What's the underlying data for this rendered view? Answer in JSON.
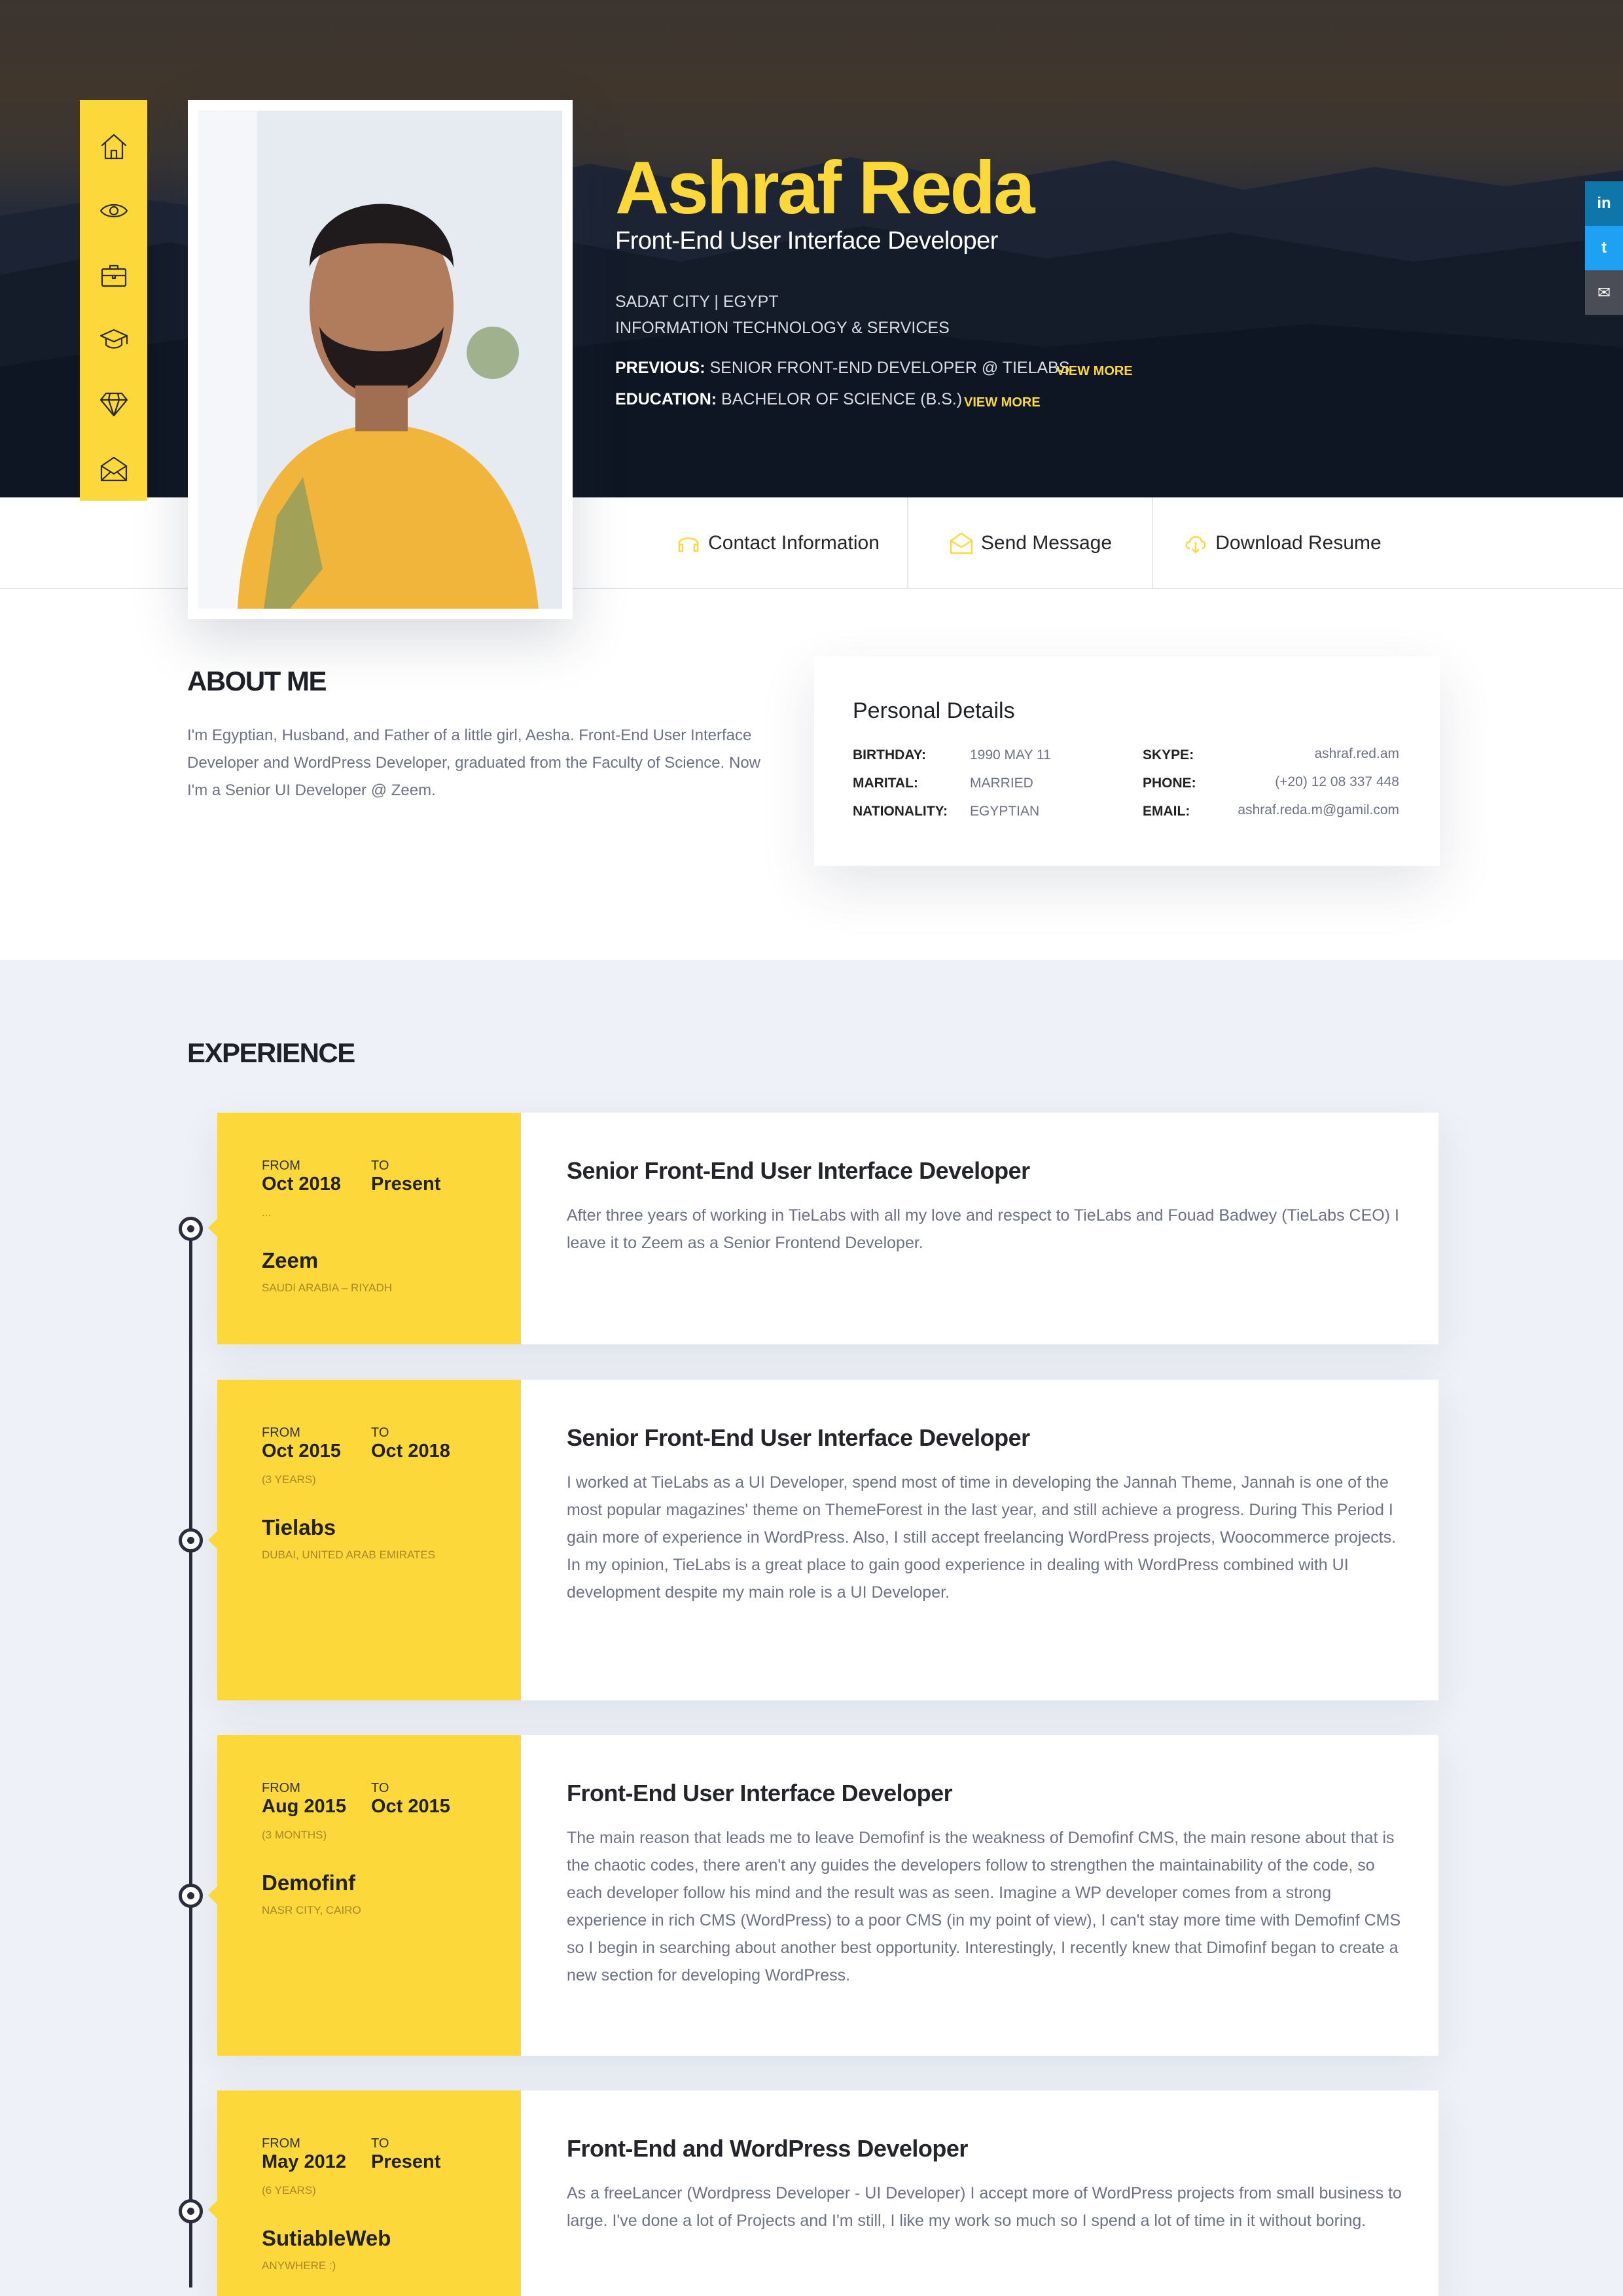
{
  "profile": {
    "name": "Ashraf Reda",
    "role": "Front-End User Interface Developer",
    "location": "SADAT CITY | EGYPT",
    "industry": "INFORMATION TECHNOLOGY & SERVICES",
    "previous_label": "PREVIOUS:",
    "previous_value": "SENIOR FRONT-END DEVELOPER @ TIELABS",
    "education_label": "EDUCATION:",
    "education_value": "BACHELOR OF SCIENCE (B.S.)",
    "view_more": "VIEW MORE"
  },
  "sidenav": [
    {
      "icon": "home-icon"
    },
    {
      "icon": "eye-icon"
    },
    {
      "icon": "briefcase-icon"
    },
    {
      "icon": "graduation-cap-icon"
    },
    {
      "icon": "diamond-icon"
    },
    {
      "icon": "envelope-icon"
    }
  ],
  "social": [
    {
      "icon": "linkedin-icon",
      "glyph": "in",
      "color": "#0e76a8"
    },
    {
      "icon": "twitter-icon",
      "glyph": "t",
      "color": "#1da1f2"
    },
    {
      "icon": "email-icon",
      "glyph": "✉",
      "color": "#4a4d55"
    }
  ],
  "actions": {
    "contact": "Contact Information",
    "message": "Send Message",
    "resume": "Download Resume"
  },
  "about": {
    "title": "ABOUT ME",
    "text": "I'm Egyptian, Husband, and Father of a little girl, Aesha. Front-End User Interface Developer and WordPress Developer, graduated from the Faculty of Science. Now I'm a Senior UI Developer @ Zeem."
  },
  "personal": {
    "title": "Personal Details",
    "birthday_k": "BIRTHDAY:",
    "birthday_v": "1990 MAY 11",
    "marital_k": "MARITAL:",
    "marital_v": "MARRIED",
    "nationality_k": "NATIONALITY:",
    "nationality_v": "EGYPTIAN",
    "skype_k": "SKYPE:",
    "skype_v": "ashraf.red.am",
    "phone_k": "PHONE:",
    "phone_v": "(+20) 12 08 337 448",
    "email_k": "EMAIL:",
    "email_v": "ashraf.reda.m@gamil.com"
  },
  "experience": {
    "title": "EXPERIENCE",
    "from_label": "FROM",
    "to_label": "TO",
    "jobs": [
      {
        "from": "Oct 2018",
        "to": "Present",
        "duration": "...",
        "company": "Zeem",
        "company_location": "SAUDI ARABIA – RIYADH",
        "title": "Senior Front-End User Interface Developer",
        "description": "After three years of working in TieLabs with all my love and respect to TieLabs and Fouad Badwey (TieLabs CEO) I leave it to Zeem as a Senior Frontend Developer."
      },
      {
        "from": "Oct 2015",
        "to": "Oct 2018",
        "duration": "(3 YEARS)",
        "company": "Tielabs",
        "company_location": "DUBAI, UNITED ARAB EMIRATES",
        "title": "Senior Front-End User Interface Developer",
        "description": "I worked at TieLabs as a UI Developer, spend most of time in developing the Jannah Theme, Jannah is one of the most popular magazines' theme on ThemeForest in the last year, and still achieve a progress. During This Period I gain more of experience in WordPress. Also, I still accept freelancing WordPress projects, Woocommerce projects. In my opinion, TieLabs is a great place to gain good experience in dealing with WordPress combined with UI development despite my main role is a UI Developer."
      },
      {
        "from": "Aug 2015",
        "to": "Oct 2015",
        "duration": "(3 MONTHS)",
        "company": "Demofinf",
        "company_location": "NASR CITY, CAIRO",
        "title": "Front-End User Interface Developer",
        "description": "The main reason that leads me to leave Demofinf is the weakness of Demofinf CMS, the main resone about that is the chaotic codes, there aren't any guides the developers follow to strengthen the maintainability of the code, so each developer follow his mind and the result was as seen. Imagine a WP developer comes from a strong experience in rich CMS (WordPress) to a poor CMS (in my point of view), I can't stay more time with Demofinf CMS so I begin in searching about another best opportunity. Interestingly, I recently knew that Dimofinf began to create a new section for developing WordPress."
      },
      {
        "from": "May 2012",
        "to": "Present",
        "duration": "(6 YEARS)",
        "company": "SutiableWeb",
        "company_location": "ANYWHERE :)",
        "title": "Front-End and WordPress Developer",
        "description": "As a freeLancer (Wordpress Developer - UI Developer) I accept more of WordPress projects from small business to large. I've done a lot of Projects and I'm still, I like my work so much so I spend a lot of time in it without boring."
      }
    ]
  },
  "colors": {
    "accent": "#fdd83a",
    "dark": "#1f2128",
    "muted": "#6c7184"
  }
}
